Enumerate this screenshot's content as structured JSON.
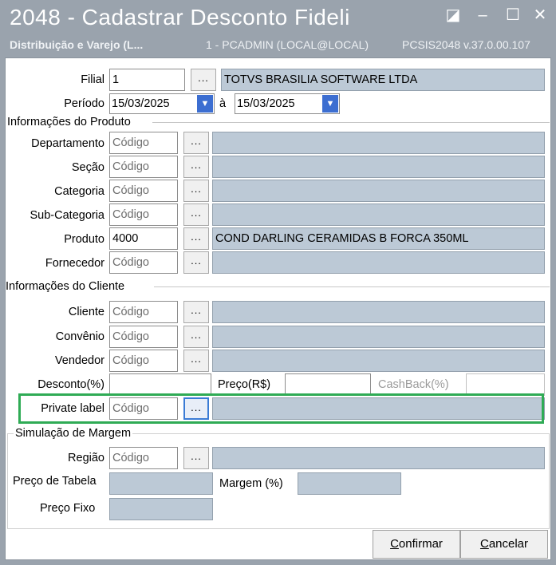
{
  "titlebar": {
    "title": "2048 - Cadastrar Desconto Fideli",
    "company": "Distribuição e Varejo (L...",
    "user": "1 - PCADMIN (LOCAL@LOCAL)",
    "version": "PCSIS2048  v.37.0.00.107"
  },
  "filial": {
    "label": "Filial",
    "value": "1",
    "description": "TOTVS BRASILIA SOFTWARE LTDA"
  },
  "periodo": {
    "label": "Período",
    "start": "15/03/2025",
    "separator": "à",
    "end": "15/03/2025"
  },
  "produto_group": {
    "title": "Informações do Produto",
    "fields": [
      {
        "label": "Departamento",
        "value": "Código",
        "placeholder": true,
        "description": ""
      },
      {
        "label": "Seção",
        "value": "Código",
        "placeholder": true,
        "description": ""
      },
      {
        "label": "Categoria",
        "value": "Código",
        "placeholder": true,
        "description": ""
      },
      {
        "label": "Sub-Categoria",
        "value": "Código",
        "placeholder": true,
        "description": ""
      },
      {
        "label": "Produto",
        "value": "4000",
        "placeholder": false,
        "description": "COND DARLING CERAMIDAS B FORCA 350ML"
      },
      {
        "label": "Fornecedor",
        "value": "Código",
        "placeholder": true,
        "description": ""
      }
    ]
  },
  "cliente_group": {
    "title": "Informações do Cliente",
    "fields": [
      {
        "label": "Cliente",
        "value": "Código",
        "description": ""
      },
      {
        "label": "Convênio",
        "value": "Código",
        "description": ""
      },
      {
        "label": "Vendedor",
        "value": "Código",
        "description": ""
      }
    ]
  },
  "desconto": {
    "label": "Desconto(%)",
    "value": ""
  },
  "preco": {
    "label": "Preço(R$)",
    "value": ""
  },
  "cashback": {
    "label": "CashBack(%)",
    "value": ""
  },
  "private_label": {
    "label": "Private label",
    "value": "Código",
    "description": ""
  },
  "simulacao": {
    "title": "Simulação de Margem",
    "regiao_label": "Região",
    "regiao_value": "Código",
    "preco_tabela_label": "Preço de Tabela",
    "margem_label": "Margem (%)",
    "preco_fixo_label": "Preço Fixo"
  },
  "buttons": {
    "ellipsis": "...",
    "confirm_u": "C",
    "confirm_rest": "onfirmar",
    "cancel_u": "C",
    "cancel_rest": "ancelar"
  },
  "window_controls": {
    "restore": "◪",
    "minimize": "–",
    "maximize": "☐",
    "close": "✕"
  },
  "colors": {
    "titlebar": "#9aa3ad",
    "readonly": "#bcc9d6",
    "highlight": "#2fab55",
    "dropdown_arrow": "#3c6ed1"
  }
}
